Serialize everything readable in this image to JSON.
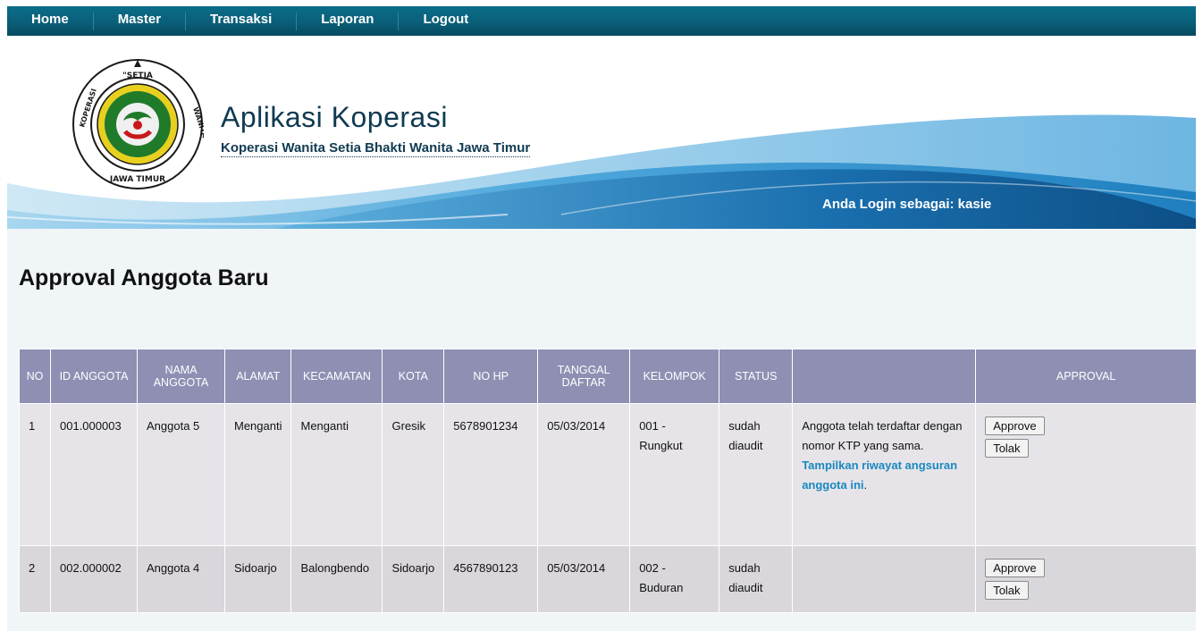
{
  "nav": {
    "items": [
      "Home",
      "Master",
      "Transaksi",
      "Laporan",
      "Logout"
    ]
  },
  "header": {
    "title": "Aplikasi Koperasi",
    "subtitle": "Koperasi Wanita Setia Bhakti Wanita Jawa Timur",
    "login_info": "Anda Login sebagai: kasie",
    "logo_text": "KOPERASI WANITA \"SETIA BHAKTI WANITA\" JAWA TIMUR"
  },
  "main": {
    "page_title": "Approval Anggota Baru",
    "columns": [
      "NO",
      "ID ANGGOTA",
      "NAMA ANGGOTA",
      "ALAMAT",
      "KECAMATAN",
      "KOTA",
      "NO HP",
      "TANGGAL DAFTAR",
      "KELOMPOK",
      "STATUS",
      "",
      "APPROVAL"
    ],
    "rows": [
      {
        "no": "1",
        "id": "001.000003",
        "nama": "Anggota 5",
        "alamat": "Menganti",
        "kecamatan": "Menganti",
        "kota": "Gresik",
        "hp": "5678901234",
        "tanggal": "05/03/2014",
        "kelompok": "001 - Rungkut",
        "status": "sudah diaudit",
        "note": "Anggota telah terdaftar dengan nomor KTP yang sama.",
        "link": "Tampilkan riwayat angsuran anggota ini",
        "link_suffix": ".",
        "approve": "Approve",
        "reject": "Tolak"
      },
      {
        "no": "2",
        "id": "002.000002",
        "nama": "Anggota 4",
        "alamat": "Sidoarjo",
        "kecamatan": "Balongbendo",
        "kota": "Sidoarjo",
        "hp": "4567890123",
        "tanggal": "05/03/2014",
        "kelompok": "002 - Buduran",
        "status": "sudah diaudit",
        "note": "",
        "link": "",
        "link_suffix": "",
        "approve": "Approve",
        "reject": "Tolak"
      }
    ]
  },
  "colors": {
    "nav_bg": "#0a6d8a",
    "header_text": "#103a52",
    "table_header": "#8e8fb3",
    "link": "#1a88c0"
  }
}
